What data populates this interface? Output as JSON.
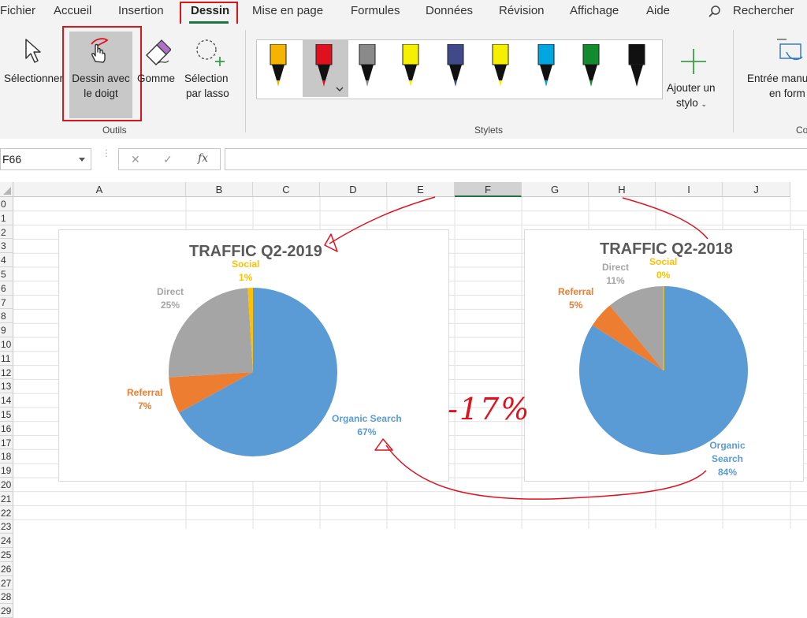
{
  "tabs": [
    {
      "label": "Fichier"
    },
    {
      "label": "Accueil"
    },
    {
      "label": "Insertion"
    },
    {
      "label": "Dessin"
    },
    {
      "label": "Mise en page"
    },
    {
      "label": "Formules"
    },
    {
      "label": "Données"
    },
    {
      "label": "Révision"
    },
    {
      "label": "Affichage"
    },
    {
      "label": "Aide"
    }
  ],
  "search": {
    "label": "Rechercher"
  },
  "ribbon": {
    "select": "Sélectionner",
    "finger_line1": "Dessin avec",
    "finger_line2": "le doigt",
    "eraser": "Gomme",
    "lasso_line1": "Sélection",
    "lasso_line2": "par lasso",
    "tools_group": "Outils",
    "pens_group": "Stylets",
    "add_pen_line1": "Ajouter un",
    "add_pen_line2": "stylo",
    "ink_line1": "Entrée manu",
    "ink_line2": "en form",
    "conv_group": "Co"
  },
  "formula_bar": {
    "name_box": "F66",
    "cancel": "✕",
    "enter": "✓",
    "fx": "fx",
    "value": ""
  },
  "columns": [
    "A",
    "B",
    "C",
    "D",
    "E",
    "F",
    "G",
    "H",
    "I",
    "J"
  ],
  "rows": [
    "0",
    "1",
    "2",
    "3",
    "4",
    "5",
    "6",
    "7",
    "8",
    "9",
    "10",
    "11",
    "12",
    "13",
    "14",
    "15",
    "16",
    "17",
    "18",
    "19",
    "20",
    "21",
    "22",
    "23",
    "24",
    "25",
    "26",
    "27",
    "28",
    "29"
  ],
  "pens": [
    {
      "color": "#f5b400"
    },
    {
      "color": "#e0101f"
    },
    {
      "color": "#8a8a8a"
    },
    {
      "color": "#f6f000"
    },
    {
      "color": "#404a8a"
    },
    {
      "color": "#f6f000"
    },
    {
      "color": "#00a6e0"
    },
    {
      "color": "#128a2e"
    },
    {
      "color": "#111111"
    }
  ],
  "annotation": {
    "text": "-17%",
    "color": "#e2101c"
  },
  "chart_data": [
    {
      "type": "pie",
      "title": "TRAFFIC Q2-2019",
      "categories": [
        "Organic Search",
        "Referral",
        "Direct",
        "Social"
      ],
      "values": [
        67,
        7,
        25,
        1
      ],
      "labels": [
        "67%",
        "7%",
        "25%",
        "1%"
      ],
      "colors": [
        "#5b9bd5",
        "#ed7d31",
        "#a5a5a5",
        "#ffc000"
      ]
    },
    {
      "type": "pie",
      "title": "TRAFFIC Q2-2018",
      "categories": [
        "Organic Search",
        "Referral",
        "Direct",
        "Social"
      ],
      "values": [
        84,
        5,
        11,
        0
      ],
      "labels": [
        "84%",
        "5%",
        "11%",
        "0%"
      ],
      "colors": [
        "#5b9bd5",
        "#ed7d31",
        "#a5a5a5",
        "#ffc000"
      ]
    }
  ]
}
